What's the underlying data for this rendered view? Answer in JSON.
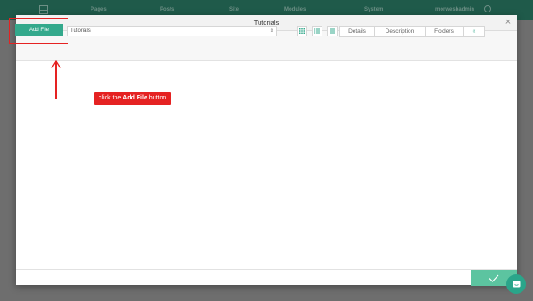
{
  "background_nav": {
    "items": [
      "Pages",
      "Posts",
      "Site",
      "Modules",
      "System",
      "morwesbadmin"
    ]
  },
  "modal": {
    "title": "Tutorials",
    "close_symbol": "×"
  },
  "toolbar": {
    "add_file_label": "Add File",
    "folder_select_value": "Tutorials",
    "folder_select_arrows": "⇕",
    "view_buttons": [
      "grid-view-icon",
      "list-view-icon",
      "detail-list-view-icon"
    ],
    "tabs": [
      "Details",
      "Description",
      "Folders",
      "«"
    ]
  },
  "annotation": {
    "prefix": "click the ",
    "bold": "Add File",
    "suffix": " button"
  },
  "colors": {
    "accent": "#34a98c",
    "confirm": "#5cc4a0",
    "annotation_red": "#e52222",
    "nav_bg": "#1f5a4a"
  }
}
